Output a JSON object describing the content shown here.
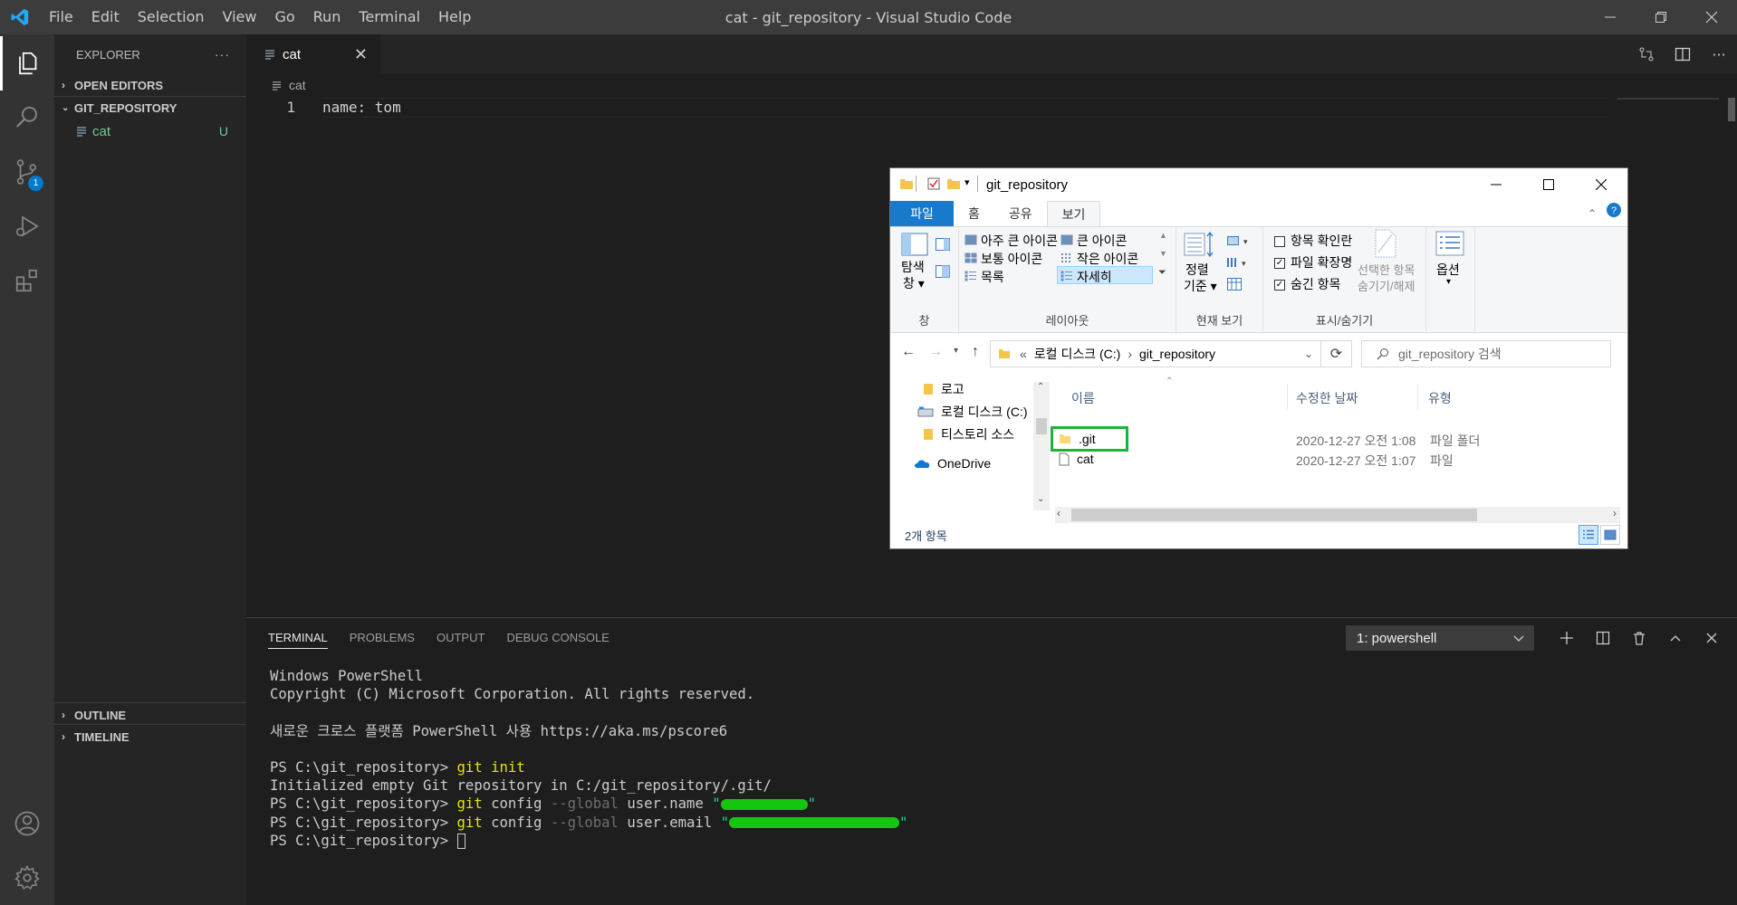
{
  "titlebar": {
    "menu": [
      "File",
      "Edit",
      "Selection",
      "View",
      "Go",
      "Run",
      "Terminal",
      "Help"
    ],
    "title": "cat - git_repository - Visual Studio Code"
  },
  "activity": {
    "scm_badge": "1"
  },
  "sidebar": {
    "header": "EXPLORER",
    "more": "···",
    "open_editors": "OPEN EDITORS",
    "repo": "GIT_REPOSITORY",
    "file": {
      "name": "cat",
      "status": "U"
    },
    "outline": "OUTLINE",
    "timeline": "TIMELINE"
  },
  "editor": {
    "tab": "cat",
    "breadcrumb": "cat",
    "line_number": "1",
    "line_text": "name: tom"
  },
  "panel": {
    "tabs": [
      "TERMINAL",
      "PROBLEMS",
      "OUTPUT",
      "DEBUG CONSOLE"
    ],
    "shell": "1: powershell",
    "lines": {
      "l1": "Windows PowerShell",
      "l2": "Copyright (C) Microsoft Corporation. All rights reserved.",
      "l3": "새로운 크로스 플랫폼 PowerShell 사용 https://aka.ms/pscore6",
      "prompt": "PS C:\\git_repository>",
      "cmd1": "git init",
      "out1": "Initialized empty Git repository in C:/git_repository/.git/",
      "cmd2_git": "git",
      "cmd2_config": "config",
      "flag": "--global",
      "cmd2_key": "user.name",
      "cmd3_key": "user.email",
      "quote": "\""
    }
  },
  "explorer": {
    "title": "git_repository",
    "tabs": [
      "파일",
      "홈",
      "공유",
      "보기"
    ],
    "ribbon": {
      "nav_pane_1": "탐색",
      "nav_pane_2": "창 ▾",
      "pane_group": "창",
      "layout_opts": [
        "아주 큰 아이콘",
        "큰 아이콘",
        "보통 아이콘",
        "작은 아이콘",
        "목록",
        "자세히"
      ],
      "layout_group": "레이아웃",
      "sort_1": "정렬",
      "sort_2": "기준 ▾",
      "current_view_group": "현재 보기",
      "checks": [
        "항목 확인란",
        "파일 확장명",
        "숨긴 항목"
      ],
      "hide_1": "선택한 항목",
      "hide_2": "숨기기/해제",
      "showhide_group": "표시/숨기기",
      "options": "옵션"
    },
    "address": {
      "chev": "«",
      "part1": "로컬 디스크 (C:)",
      "part2": "git_repository"
    },
    "search_placeholder": "git_repository 검색",
    "nav_items": [
      "로고",
      "로컬 디스크 (C:)",
      "티스토리 소스",
      "OneDrive"
    ],
    "columns": {
      "name": "이름",
      "modified": "수정한 날짜",
      "type": "유형"
    },
    "rows": [
      {
        "name": ".git",
        "date": "2020-12-27 오전 1:08",
        "type": "파일 폴더"
      },
      {
        "name": "cat",
        "date": "2020-12-27 오전 1:07",
        "type": "파일"
      }
    ],
    "status": "2개 항목"
  },
  "colors": {
    "accent": "#007acc",
    "highlight_box": "#1db33b"
  }
}
